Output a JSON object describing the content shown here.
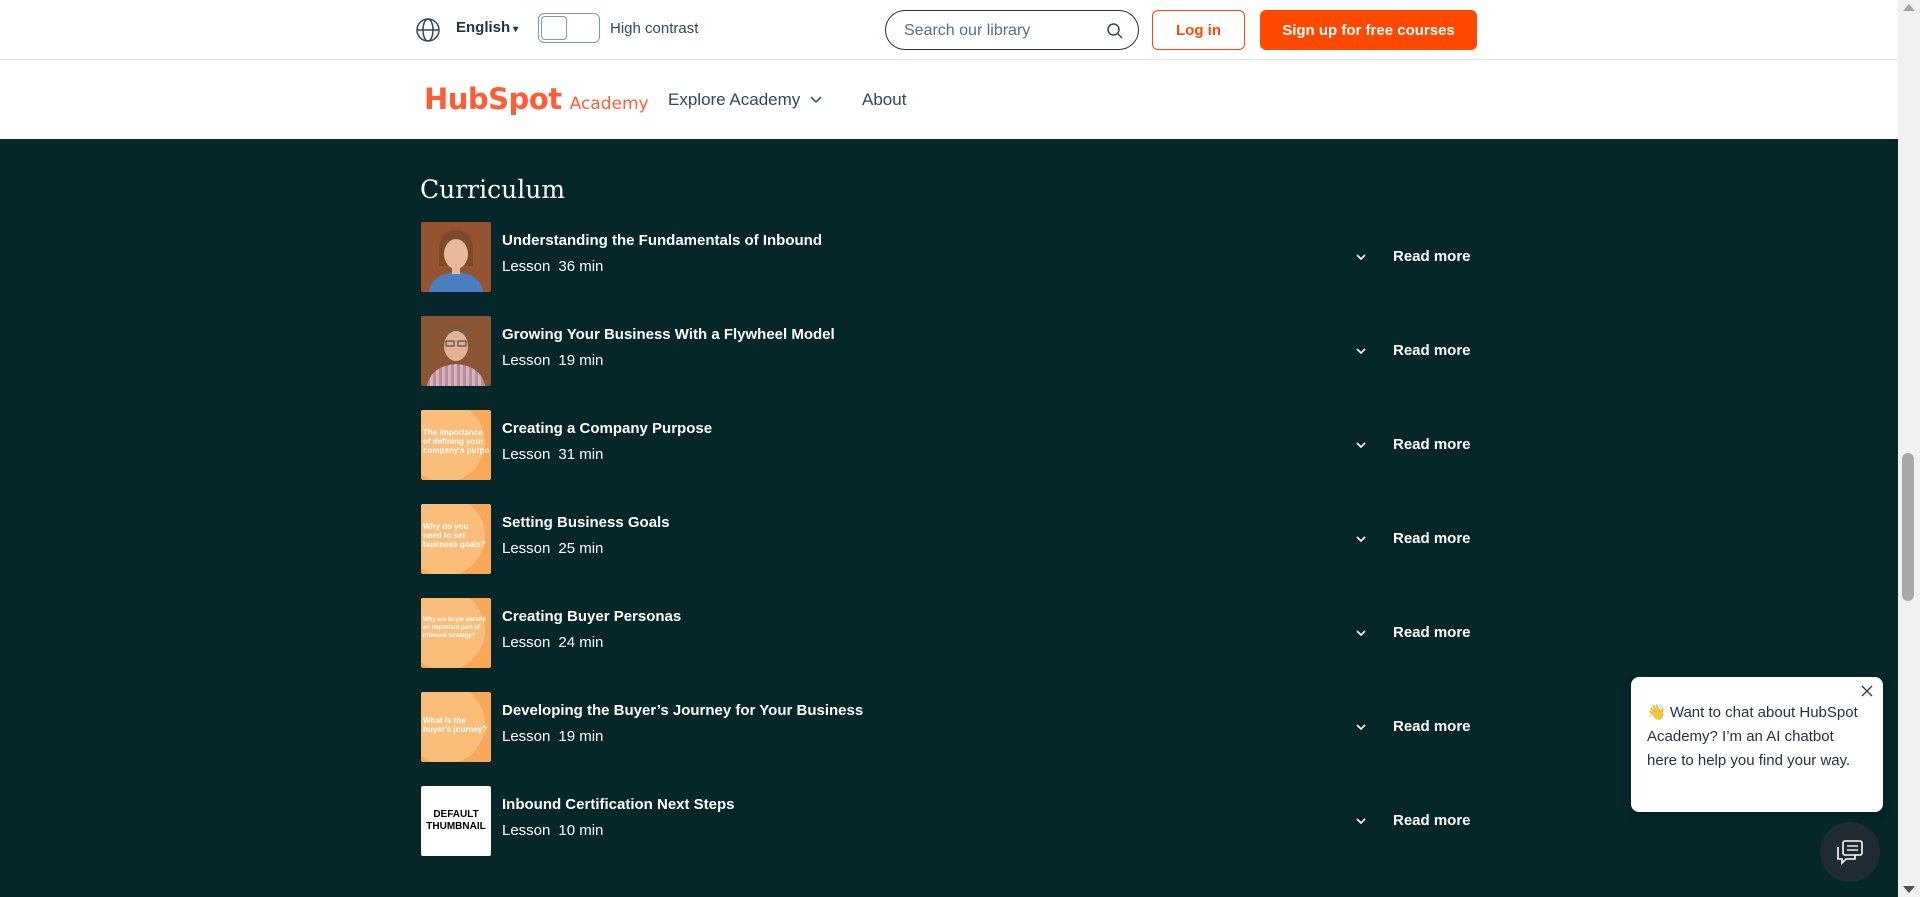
{
  "topbar": {
    "language": "English",
    "high_contrast_label": "High contrast",
    "search_placeholder": "Search our library",
    "login_label": "Log in",
    "signup_label": "Sign up for free courses"
  },
  "nav": {
    "logo_text": "HubSpot",
    "logo_sub": "Academy",
    "explore_label": "Explore Academy",
    "about_label": "About"
  },
  "curriculum": {
    "title": "Curriculum",
    "read_more": "Read more",
    "lessons": [
      {
        "title": "Understanding the Fundamentals of Inbound",
        "type": "Lesson",
        "duration": "36 min",
        "thumb": "photo-woman"
      },
      {
        "title": "Growing Your Business With a Flywheel Model",
        "type": "Lesson",
        "duration": "19 min",
        "thumb": "photo-man"
      },
      {
        "title": "Creating a Company Purpose",
        "type": "Lesson",
        "duration": "31 min",
        "thumb": "orange",
        "thumb_text": "The importance\nof defining your\ncompany's purpo"
      },
      {
        "title": "Setting Business Goals",
        "type": "Lesson",
        "duration": "25 min",
        "thumb": "orange",
        "thumb_text": "Why do you\nneed to set\nbusiness goals?"
      },
      {
        "title": "Creating Buyer Personas",
        "type": "Lesson",
        "duration": "24 min",
        "thumb": "orange",
        "thumb_text": "Why are buyer persos\nan important part of\ninbound strategy?"
      },
      {
        "title": "Developing the Buyer’s Journey for Your Business",
        "type": "Lesson",
        "duration": "19 min",
        "thumb": "orange",
        "thumb_text": "What is the\nbuyer's journey?"
      },
      {
        "title": "Inbound Certification Next Steps",
        "type": "Lesson",
        "duration": "10 min",
        "thumb": "default",
        "thumb_text": "DEFAULT\nTHUMBNAIL"
      }
    ]
  },
  "chat": {
    "message": "👋 Want to chat about HubSpot Academy? I’m an AI chatbot here to help you find your way."
  },
  "colors": {
    "brand_orange": "#ff4800",
    "dark_teal": "#05272a"
  }
}
